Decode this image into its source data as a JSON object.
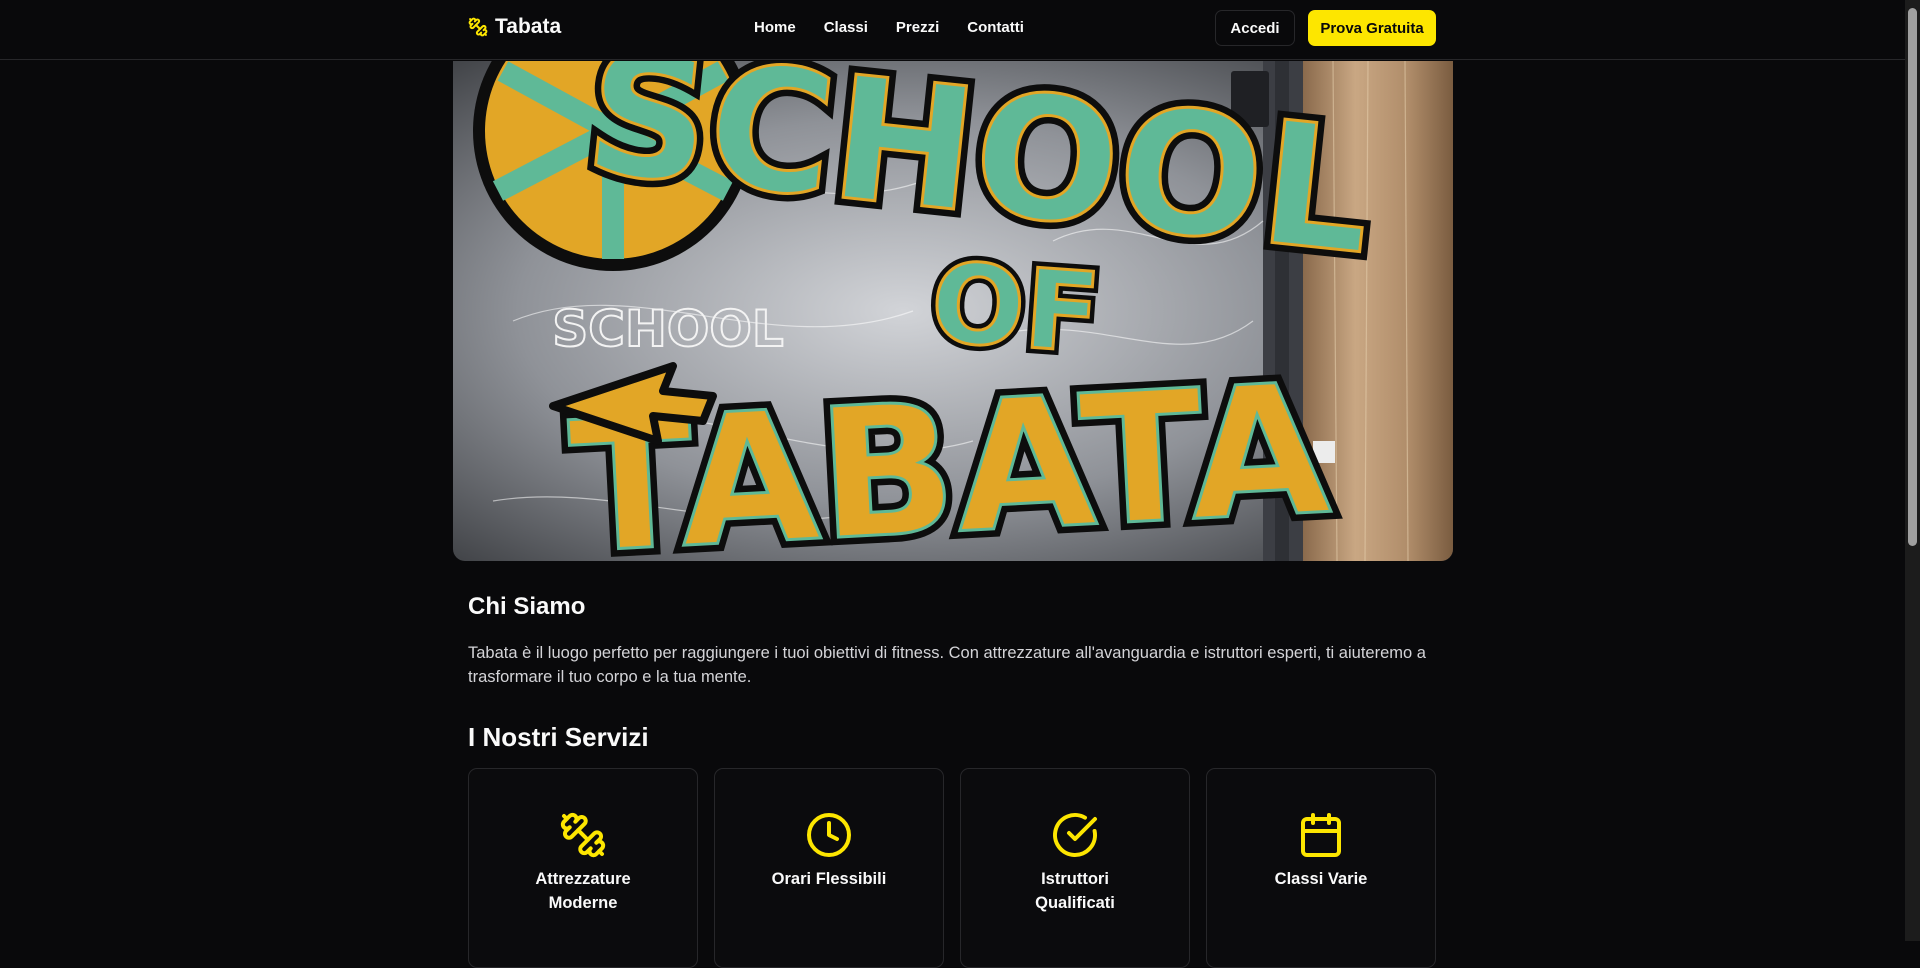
{
  "brand": {
    "name": "Tabata",
    "accent": "#fde600",
    "logo_icon": "dumbbell-icon"
  },
  "nav": {
    "items": [
      {
        "label": "Home"
      },
      {
        "label": "Classi"
      },
      {
        "label": "Prezzi"
      },
      {
        "label": "Contatti"
      }
    ]
  },
  "header": {
    "login_label": "Accedi",
    "trial_label": "Prova Gratuita"
  },
  "hero": {
    "image_text_lines": [
      "SCHOOL",
      "OF",
      "TABATA"
    ],
    "sketch_text": "SCHOOL"
  },
  "about": {
    "title": "Chi Siamo",
    "text": "Tabata è il luogo perfetto per raggiungere i tuoi obiettivi di fitness. Con attrezzature all'avanguardia e istruttori esperti, ti aiuteremo a trasformare il tuo corpo e la tua mente."
  },
  "services": {
    "title": "I Nostri Servizi",
    "items": [
      {
        "title": "Attrezzature Moderne",
        "icon": "dumbbell-icon"
      },
      {
        "title": "Orari Flessibili",
        "icon": "clock-icon"
      },
      {
        "title": "Istruttori Qualificati",
        "icon": "check-circle-icon"
      },
      {
        "title": "Classi Varie",
        "icon": "calendar-icon"
      }
    ]
  }
}
